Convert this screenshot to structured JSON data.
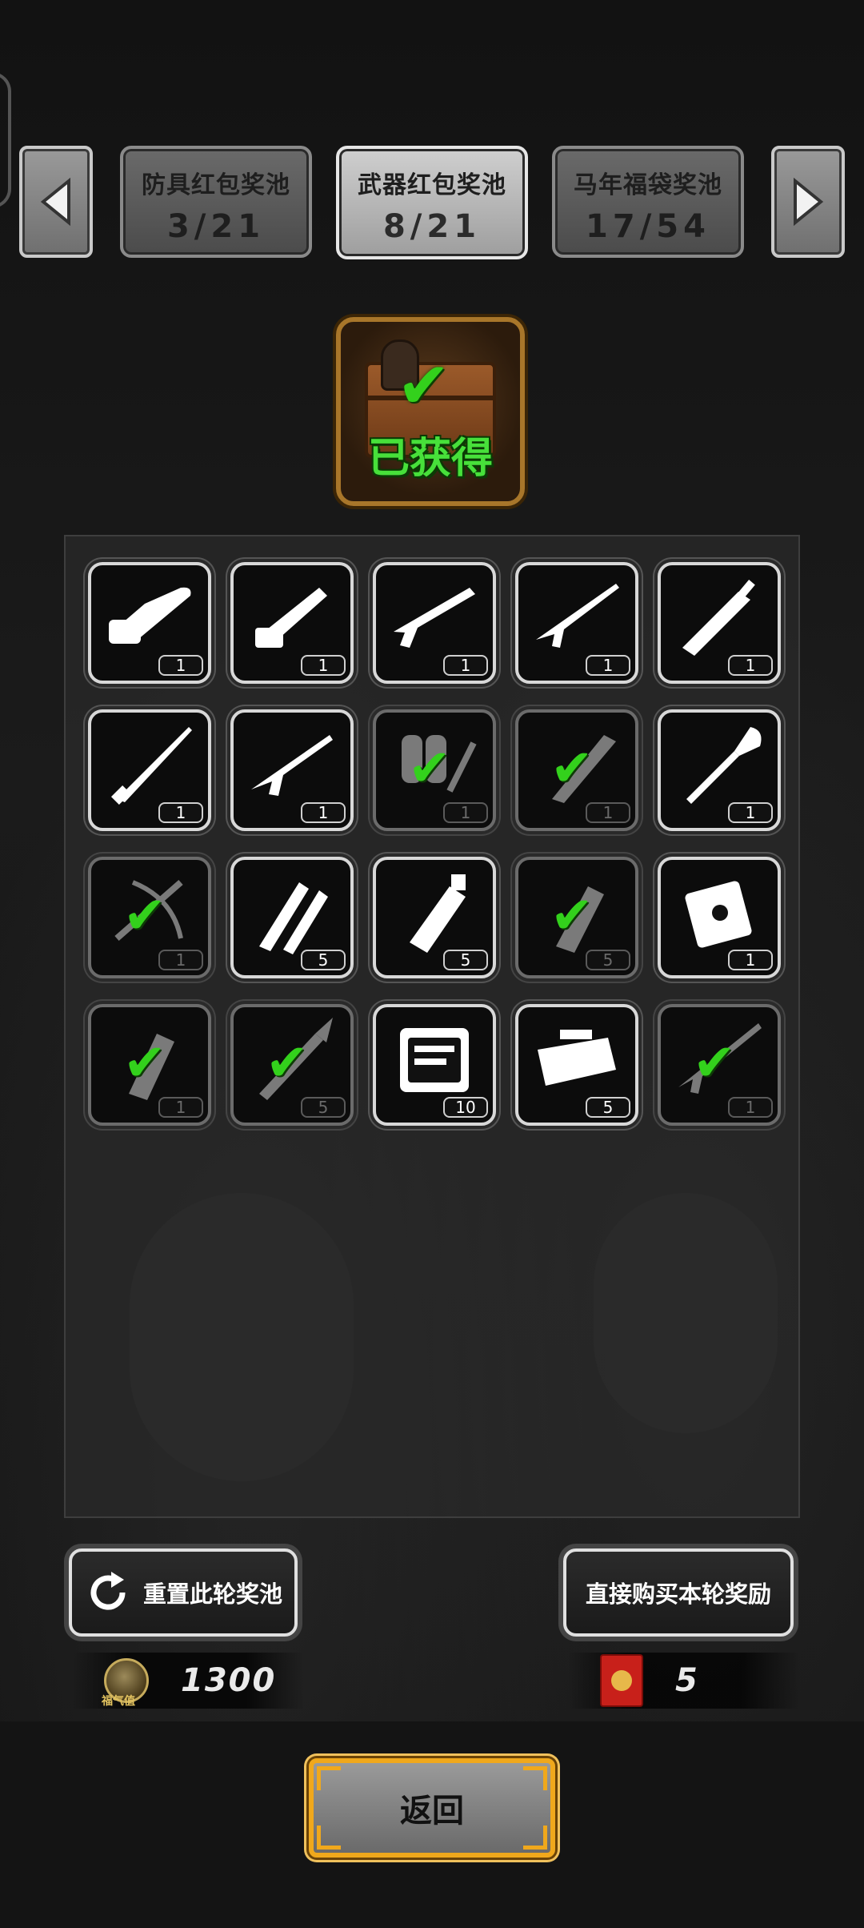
{
  "tabs": [
    {
      "name": "防具红包奖池",
      "progress": "3/21",
      "active": false
    },
    {
      "name": "武器红包奖池",
      "progress": "8/21",
      "active": true
    },
    {
      "name": "马年福袋奖池",
      "progress": "17/54",
      "active": false
    }
  ],
  "chest": {
    "status_label": "已获得"
  },
  "items": [
    {
      "icon": "chainsaw-icon",
      "count": "1",
      "obtained": false
    },
    {
      "icon": "gatling-gun-icon",
      "count": "1",
      "obtained": false
    },
    {
      "icon": "shotgun-icon",
      "count": "1",
      "obtained": false
    },
    {
      "icon": "rifle-icon",
      "count": "1",
      "obtained": false
    },
    {
      "icon": "broadsword-icon",
      "count": "1",
      "obtained": false
    },
    {
      "icon": "spear-icon",
      "count": "1",
      "obtained": false
    },
    {
      "icon": "assault-rifle-icon",
      "count": "1",
      "obtained": false
    },
    {
      "icon": "flamethrower-icon",
      "count": "1",
      "obtained": true
    },
    {
      "icon": "machete-icon",
      "count": "1",
      "obtained": true
    },
    {
      "icon": "shovel-icon",
      "count": "1",
      "obtained": false
    },
    {
      "icon": "crossbow-icon",
      "count": "1",
      "obtained": true
    },
    {
      "icon": "bullets-icon",
      "count": "5",
      "obtained": false
    },
    {
      "icon": "flashbang-grenade-icon",
      "count": "5",
      "obtained": false
    },
    {
      "icon": "frag-grenade-icon",
      "count": "5",
      "obtained": true
    },
    {
      "icon": "incendiary-pack-icon",
      "count": "1",
      "obtained": false
    },
    {
      "icon": "smoke-grenade-icon",
      "count": "1",
      "obtained": true
    },
    {
      "icon": "rpg-icon",
      "count": "5",
      "obtained": true
    },
    {
      "icon": "repair-kit-icon",
      "count": "10",
      "obtained": false
    },
    {
      "icon": "toolbox-icon",
      "count": "5",
      "obtained": false
    },
    {
      "icon": "sniper-rifle-icon",
      "count": "1",
      "obtained": true
    }
  ],
  "buttons": {
    "reset_label": "重置此轮奖池",
    "buy_label": "直接购买本轮奖励",
    "back_label": "返回"
  },
  "currency": {
    "fortune_label": "福气值",
    "fortune_value": "1300",
    "redpacket_value": "5"
  },
  "colors": {
    "check_green": "#33d11c",
    "back_border": "#f0a81c",
    "chest_label_green": "#47e03a"
  }
}
